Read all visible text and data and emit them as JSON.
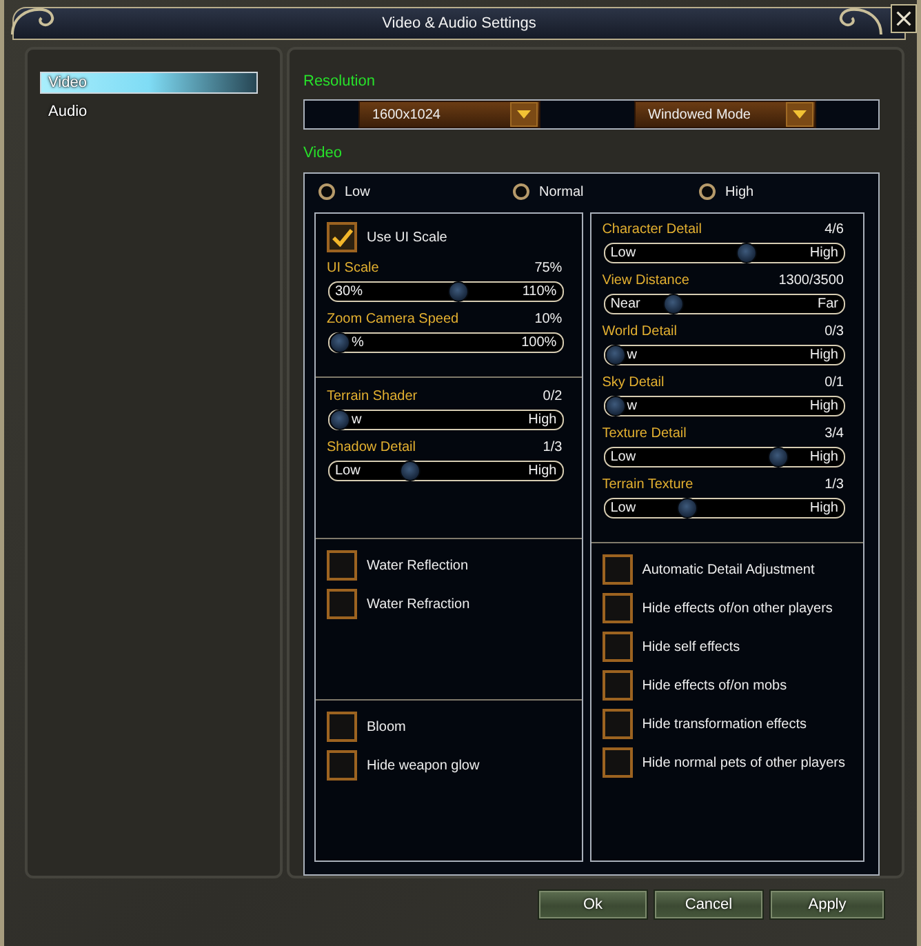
{
  "window": {
    "title": "Video & Audio Settings"
  },
  "sidebar": {
    "items": [
      {
        "label": "Video",
        "selected": true
      },
      {
        "label": "Audio",
        "selected": false
      }
    ]
  },
  "resolution": {
    "heading": "Resolution",
    "dropdowns": [
      {
        "value": "1600x1024"
      },
      {
        "value": "Windowed Mode"
      }
    ]
  },
  "video": {
    "heading": "Video",
    "presets": [
      {
        "label": "Low",
        "selected": false
      },
      {
        "label": "Normal",
        "selected": false
      },
      {
        "label": "High",
        "selected": false
      }
    ],
    "columns": [
      {
        "sections": [
          {
            "items": [
              {
                "kind": "checkbox",
                "label": "Use UI Scale",
                "checked": true
              },
              {
                "kind": "slider",
                "label": "UI Scale",
                "reading": "75%",
                "min_label": "30%",
                "max_label": "110%",
                "level": 0.56
              },
              {
                "kind": "slider",
                "label": "Zoom Camera Speed",
                "reading": "10%",
                "min_label": "%",
                "max_label": "100%",
                "level": 0
              }
            ]
          },
          {
            "items": [
              {
                "kind": "slider",
                "label": "Terrain Shader",
                "reading": "0/2",
                "min_label": "w",
                "max_label": "High",
                "level": 0
              },
              {
                "kind": "slider",
                "label": "Shadow Detail",
                "reading": "1/3",
                "min_label": "Low",
                "max_label": "High",
                "level": 0.33
              }
            ]
          },
          {
            "items": [
              {
                "kind": "checkbox",
                "label": "Water Reflection",
                "checked": false
              },
              {
                "kind": "checkbox",
                "label": "Water Refraction",
                "checked": false
              }
            ]
          },
          {
            "items": [
              {
                "kind": "checkbox",
                "label": "Bloom",
                "checked": false
              },
              {
                "kind": "checkbox",
                "label": "Hide weapon glow",
                "checked": false
              }
            ]
          }
        ]
      },
      {
        "sections": [
          {
            "items": [
              {
                "kind": "slider",
                "label": "Character Detail",
                "reading": "4/6",
                "min_label": "Low",
                "max_label": "High",
                "level": 0.6
              },
              {
                "kind": "slider",
                "label": "View Distance",
                "reading": "1300/3500",
                "min_label": "Near",
                "max_label": "Far",
                "level": 0.27
              },
              {
                "kind": "slider",
                "label": "World Detail",
                "reading": "0/3",
                "min_label": "w",
                "max_label": "High",
                "level": 0
              },
              {
                "kind": "slider",
                "label": "Sky Detail",
                "reading": "0/1",
                "min_label": "w",
                "max_label": "High",
                "level": 0
              },
              {
                "kind": "slider",
                "label": "Texture Detail",
                "reading": "3/4",
                "min_label": "Low",
                "max_label": "High",
                "level": 0.75
              },
              {
                "kind": "slider",
                "label": "Terrain Texture",
                "reading": "1/3",
                "min_label": "Low",
                "max_label": "High",
                "level": 0.33
              }
            ]
          },
          {
            "items": [
              {
                "kind": "checkbox",
                "label": "Automatic Detail Adjustment",
                "checked": false
              },
              {
                "kind": "checkbox",
                "label": "Hide effects of/on other players",
                "checked": false
              },
              {
                "kind": "checkbox",
                "label": "Hide self effects",
                "checked": false
              },
              {
                "kind": "checkbox",
                "label": "Hide effects of/on mobs",
                "checked": false
              },
              {
                "kind": "checkbox",
                "label": "Hide transformation effects",
                "checked": false
              },
              {
                "kind": "checkbox",
                "label": "Hide normal pets of other players",
                "checked": false
              }
            ]
          }
        ]
      }
    ]
  },
  "buttons": [
    {
      "label": "Ok"
    },
    {
      "label": "Cancel"
    },
    {
      "label": "Apply"
    }
  ]
}
